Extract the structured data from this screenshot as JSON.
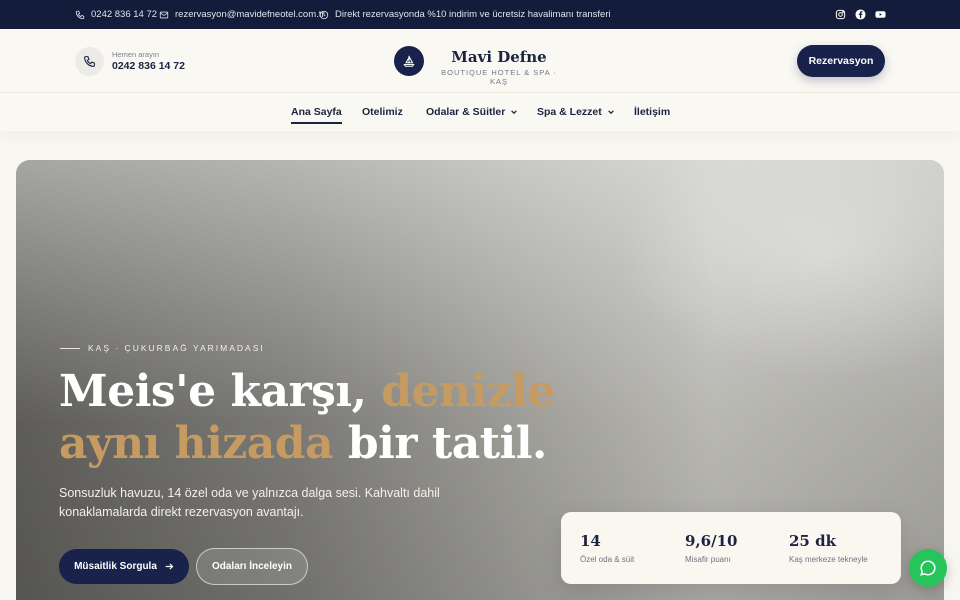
{
  "topbar": {
    "phone": "0242 836 14 72",
    "email": "rezervasyon@mavidefneotel.com.tr",
    "promo": "Direkt rezervasyonda %10 indirim ve ücretsiz havalimanı transferi",
    "social": [
      "instagram-icon",
      "facebook-icon",
      "youtube-icon"
    ]
  },
  "header": {
    "call_label": "Hemen arayın",
    "call_number": "0242 836 14 72",
    "brand_name": "Mavi Defne",
    "brand_tagline": "BOUTIQUE HOTEL & SPA · KAŞ",
    "reserve_label": "Rezervasyon"
  },
  "nav": {
    "items": [
      {
        "label": "Ana Sayfa",
        "active": true
      },
      {
        "label": "Otelimiz"
      },
      {
        "label": "Odalar & Süitler",
        "dropdown": true
      },
      {
        "label": "Spa & Lezzet",
        "dropdown": true
      },
      {
        "label": "İletişim"
      }
    ]
  },
  "hero": {
    "eyebrow": "KAŞ · ÇUKURBAĞ YARIMADASI",
    "headline_part1": "Meis'e karşı, ",
    "headline_gold": "denizle aynı hizada",
    "headline_part2": " bir tatil.",
    "subtitle": "Sonsuzluk havuzu, 14 özel oda ve yalnızca dalga sesi. Kahvaltı dahil konaklamalarda direkt rezervasyon avantajı.",
    "primary_cta": "Müsaitlik Sorgula",
    "secondary_cta": "Odaları İnceleyin"
  },
  "stats": [
    {
      "value": "14",
      "label": "Özel oda & süit"
    },
    {
      "value": "9,6/10",
      "label": "Misafir puanı"
    },
    {
      "value": "25 dk",
      "label": "Kaş merkeze tekneyle"
    }
  ],
  "colors": {
    "navy": "#18224a",
    "gold": "#c59b62",
    "cream": "#faf8f3",
    "whatsapp": "#27c45b"
  }
}
